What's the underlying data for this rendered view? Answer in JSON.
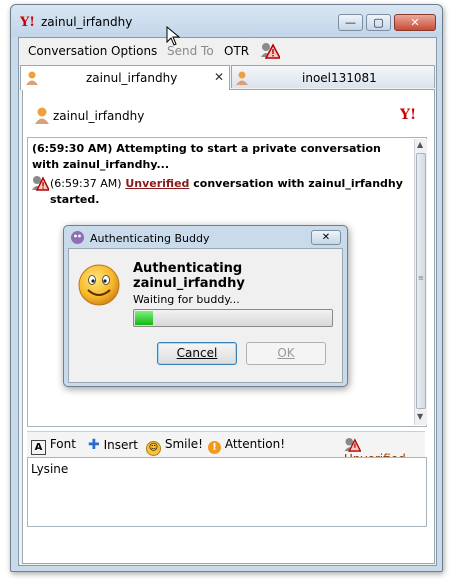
{
  "window": {
    "title": "zainul_irfandhy",
    "minimize": "—",
    "maximize": "▢",
    "close": "✕"
  },
  "menu": {
    "items": [
      {
        "label": "Conversation"
      },
      {
        "label": "Options"
      },
      {
        "label": "Send To"
      },
      {
        "label": "OTR"
      }
    ]
  },
  "tabs": [
    {
      "label": "zainul_irfandhy",
      "close": "✕"
    },
    {
      "label": "inoel131081"
    }
  ],
  "conversation": {
    "buddy_name": "zainul_irfandhy",
    "log": [
      {
        "text": "(6:59:30 AM) Attempting to start a private conversation with zainul_irfandhy..."
      },
      {
        "time": "(6:59:37 AM)",
        "link": "Unverified",
        "rest": "conversation with zainul_irfandhy started."
      }
    ]
  },
  "toolbar": {
    "font": "Font",
    "insert": "Insert",
    "smile": "Smile!",
    "attention": "Attention!",
    "status": "Unverified"
  },
  "input": {
    "value": "Lysine"
  },
  "dialog": {
    "title": "Authenticating Buddy",
    "close": "✕",
    "heading": "Authenticating zainul_irfandhy",
    "status": "Waiting for buddy...",
    "progress": 0.09,
    "cancel": "Cancel",
    "ok": "OK"
  },
  "colors": {
    "unverified": "#8b1a1a",
    "progress": "#12b812"
  }
}
